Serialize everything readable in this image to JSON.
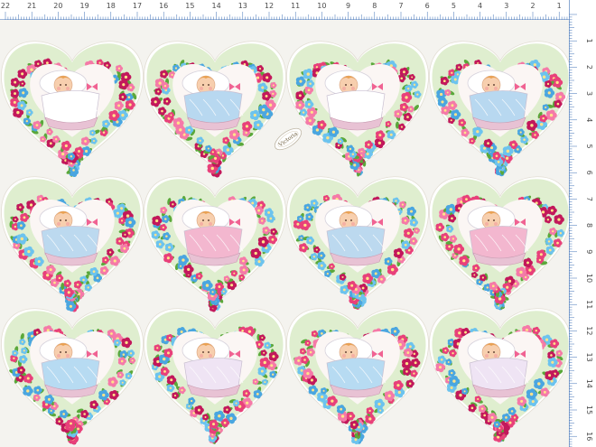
{
  "ruler": {
    "top_labels": [
      "22",
      "21",
      "20",
      "19",
      "18",
      "17",
      "16",
      "15",
      "14",
      "13",
      "12",
      "11",
      "10",
      "9",
      "8",
      "7",
      "6",
      "5",
      "4",
      "3",
      "2",
      "1"
    ],
    "right_labels": [
      "1",
      "2",
      "3",
      "4",
      "5",
      "6",
      "7",
      "8",
      "9",
      "10",
      "11",
      "12",
      "13",
      "14",
      "15",
      "16"
    ],
    "colors": {
      "paper": "#ffffff",
      "lines": "#3c6fb5",
      "text": "#4a4a4a"
    }
  },
  "sheet": {
    "rows": 3,
    "columns": 4,
    "background": "#f4f3ef",
    "tag_text": "Victoria",
    "hearts": [
      {
        "row": 1,
        "col": 1,
        "scene": "baby-in-basket",
        "blanket_color": "#ffffff"
      },
      {
        "row": 1,
        "col": 2,
        "scene": "baby-in-crib",
        "blanket_color": "#b8d8f0"
      },
      {
        "row": 1,
        "col": 3,
        "scene": "baby-in-basket",
        "blanket_color": "#ffffff"
      },
      {
        "row": 1,
        "col": 4,
        "scene": "baby-in-crib",
        "blanket_color": "#b8d8f0"
      },
      {
        "row": 2,
        "col": 1,
        "scene": "baby-in-cradle",
        "blanket_color": "#bcd9ef"
      },
      {
        "row": 2,
        "col": 2,
        "scene": "baby-with-quilt",
        "blanket_color": "#f3b7cf"
      },
      {
        "row": 2,
        "col": 3,
        "scene": "baby-in-cradle",
        "blanket_color": "#bcd9ef"
      },
      {
        "row": 2,
        "col": 4,
        "scene": "baby-with-quilt",
        "blanket_color": "#f3b7cf"
      },
      {
        "row": 3,
        "col": 1,
        "scene": "baby-in-bed",
        "blanket_color": "#b7dbf2"
      },
      {
        "row": 3,
        "col": 2,
        "scene": "baby-in-bed",
        "blanket_color": "#efe4f4"
      },
      {
        "row": 3,
        "col": 3,
        "scene": "baby-in-bed",
        "blanket_color": "#b7dbf2"
      },
      {
        "row": 3,
        "col": 4,
        "scene": "baby-in-bed",
        "blanket_color": "#efe4f4"
      }
    ],
    "flower_colors": [
      "#e8407a",
      "#f57aa8",
      "#4aa6e0",
      "#6cc3ee",
      "#c2185b"
    ],
    "leaf_color": "#5aa83a"
  }
}
